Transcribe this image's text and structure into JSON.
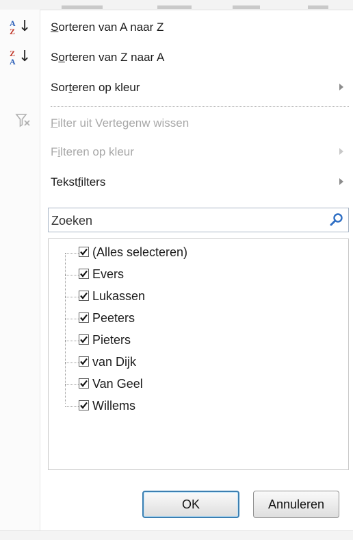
{
  "menu": {
    "sort_az": {
      "pre": "",
      "key": "S",
      "post": "orteren van A naar Z",
      "icon_top": "A",
      "icon_bottom": "Z"
    },
    "sort_za": {
      "pre": "S",
      "key": "o",
      "post": "rteren van Z naar A",
      "icon_top": "Z",
      "icon_bottom": "A"
    },
    "sort_color": {
      "pre": "Sor",
      "key": "t",
      "post": "eren op kleur"
    },
    "clear_filter": {
      "pre": "",
      "key": "F",
      "post": "ilter uit Vertegenw wissen"
    },
    "filter_color": {
      "pre": "F",
      "key": "i",
      "post": "lteren op kleur"
    },
    "text_filters": {
      "pre": "Tekst",
      "key": "f",
      "post": "ilters"
    }
  },
  "search": {
    "placeholder": "Zoeken"
  },
  "list": {
    "items": [
      {
        "label": "(Alles selecteren)",
        "checked": true
      },
      {
        "label": "Evers",
        "checked": true
      },
      {
        "label": "Lukassen",
        "checked": true
      },
      {
        "label": "Peeters",
        "checked": true
      },
      {
        "label": "Pieters",
        "checked": true
      },
      {
        "label": "van Dijk",
        "checked": true
      },
      {
        "label": "Van Geel",
        "checked": true
      },
      {
        "label": "Willems",
        "checked": true
      }
    ]
  },
  "buttons": {
    "ok": "OK",
    "cancel": "Annuleren"
  },
  "colors": {
    "accent_blue": "#2b5fb8",
    "accent_red": "#c0392b",
    "ok_border": "#3c7fb1"
  }
}
